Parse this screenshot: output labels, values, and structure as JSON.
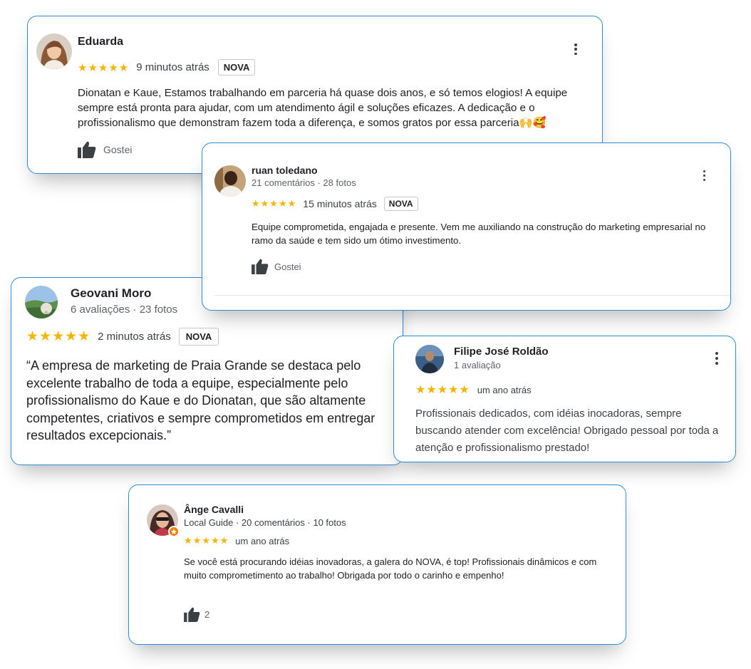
{
  "colors": {
    "accent_border": "#2d8bd8",
    "star": "#f4b400"
  },
  "reviews": [
    {
      "name": "Eduarda",
      "stars": "★★★★★",
      "time": "9 minutos atrás",
      "badge": "NOVA",
      "text": "Dionatan e Kaue, Estamos trabalhando em parceria há quase dois anos, e só temos elogios! A equipe sempre está pronta para ajudar, com um atendimento ágil e soluções eficazes. A dedicação e o profissionalismo que demonstram fazem toda a diferença, e somos gratos por essa parceria🙌🥰",
      "like_label": "Gostei",
      "icons": {
        "avatar": "avatar-photo",
        "like": "thumbs-up-icon",
        "more": "more-vertical-icon"
      }
    },
    {
      "name": "ruan toledano",
      "meta": "21 comentários · 28 fotos",
      "stars": "★★★★★",
      "time": "15 minutos atrás",
      "badge": "NOVA",
      "text": "Equipe comprometida, engajada e presente. Vem me auxiliando na construção do marketing empresarial no ramo da saúde e tem sido um ótimo investimento.",
      "like_label": "Gostei"
    },
    {
      "name": "Geovani Moro",
      "meta": "6 avaliações · 23 fotos",
      "stars": "★★★★★",
      "time": "2 minutos atrás",
      "badge": "NOVA",
      "text": "“A empresa de marketing de Praia Grande se destaca pelo excelente trabalho de toda a equipe, especialmente pelo profissionalismo do Kaue e do Dionatan, que são altamente competentes, criativos e sempre comprometidos em entregar resultados excepcionais.”"
    },
    {
      "name": "Filipe José Roldão",
      "meta": "1 avaliação",
      "stars": "★★★★★",
      "time": "um ano atrás",
      "text": "Profissionais dedicados, com idéias inocadoras, sempre buscando atender com excelência! Obrigado pessoal por toda a atenção e profissionalismo prestado!"
    },
    {
      "name": "Ânge Cavalli",
      "meta": "Local Guide · 20 comentários · 10 fotos",
      "stars": "★★★★★",
      "time": "um ano atrás",
      "text": "Se você está procurando idéias inovadoras, a galera do NOVA, é top! Profissionais dinâmicos e com muito comprometimento ao trabalho! Obrigada por todo o carinho e empenho!",
      "like_count": "2"
    }
  ]
}
